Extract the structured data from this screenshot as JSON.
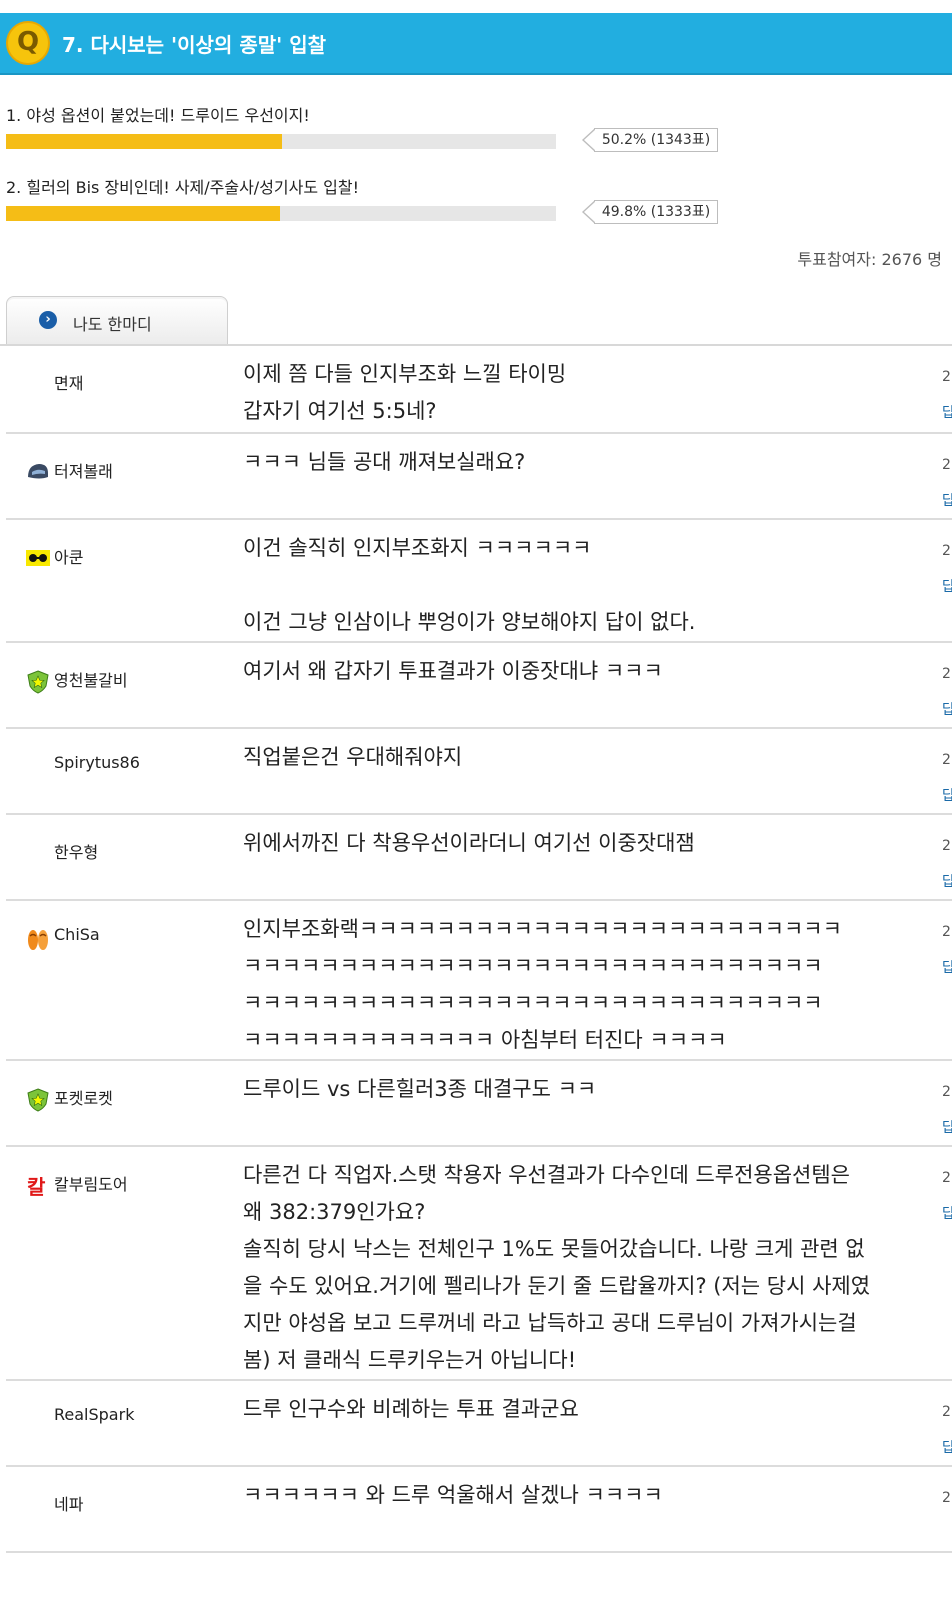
{
  "poll": {
    "badge": "Q",
    "question": "7. 다시보는 '이상의 종말' 입찰",
    "options": [
      {
        "label": "1.  야성 옵션이 붙었는데! 드루이드 우선이지!",
        "percent": 50.2,
        "result": "50.2% (1343표)"
      },
      {
        "label": "2.  힐러의 Bis 장비인데! 사제/주술사/성기사도 입찰!",
        "percent": 49.8,
        "result": "49.8% (1333표)"
      }
    ],
    "total": "투표참여자: 2676 명",
    "bar_color": "#f5bd16",
    "header_color": "#22aee0"
  },
  "tab": {
    "label": "나도 한마디",
    "icon": "chevron-right-circle-icon"
  },
  "comments": [
    {
      "user": "면재",
      "icon": "none",
      "lines": [
        "이제 쯤 다들 인지부조화 느낄 타이밍",
        "갑자기 여기선 5:5네?"
      ],
      "meta": [
        "2",
        "답"
      ]
    },
    {
      "user": "터져볼래",
      "icon": "helmet-icon",
      "lines": [
        "ㅋㅋㅋ 님들 공대 깨져보실래요?"
      ],
      "meta": [
        "2",
        "답"
      ]
    },
    {
      "user": "아쿤",
      "icon": "goggles-icon",
      "lines": [
        "이건 솔직히 인지부조화지 ㅋㅋㅋㅋㅋㅋ",
        "",
        "이건 그냥 인삼이나 뿌엉이가 양보해야지 답이 없다."
      ],
      "meta": [
        "2",
        "답"
      ]
    },
    {
      "user": "영천불갈비",
      "icon": "star-shield-icon",
      "lines": [
        "여기서 왜 갑자기 투표결과가 이중잣대냐 ㅋㅋㅋ"
      ],
      "meta": [
        "2",
        "답"
      ]
    },
    {
      "user": "Spirytus86",
      "icon": "none",
      "lines": [
        "직업붙은건 우대해줘야지"
      ],
      "meta": [
        "2",
        "답"
      ]
    },
    {
      "user": "한우형",
      "icon": "none",
      "lines": [
        "위에서까진 다 착용우선이라더니 여기선 이중잣대잼"
      ],
      "meta": [
        "2",
        "답"
      ]
    },
    {
      "user": "ChiSa",
      "icon": "sandals-icon",
      "lines": [
        "인지부조화랙ㅋㅋㅋㅋㅋㅋㅋㅋㅋㅋㅋㅋㅋㅋㅋㅋㅋㅋㅋㅋㅋㅋㅋㅋㅋ",
        "ㅋㅋㅋㅋㅋㅋㅋㅋㅋㅋㅋㅋㅋㅋㅋㅋㅋㅋㅋㅋㅋㅋㅋㅋㅋㅋㅋㅋㅋㅋ",
        "ㅋㅋㅋㅋㅋㅋㅋㅋㅋㅋㅋㅋㅋㅋㅋㅋㅋㅋㅋㅋㅋㅋㅋㅋㅋㅋㅋㅋㅋㅋ",
        "ㅋㅋㅋㅋㅋㅋㅋㅋㅋㅋㅋㅋㅋ 아침부터 터진다 ㅋㅋㅋㅋ"
      ],
      "meta": [
        "2",
        "답"
      ]
    },
    {
      "user": "포켓로켓",
      "icon": "star-shield-icon",
      "lines": [
        "드루이드 vs 다른힐러3종 대결구도 ㅋㅋ"
      ],
      "meta": [
        "2",
        "답"
      ]
    },
    {
      "user": "칼부림도어",
      "icon": "kal-icon",
      "lines": [
        "다른건 다 직업자.스탯 착용자 우선결과가 다수인데 드루전용옵션템은",
        "왜 382:379인가요?",
        "솔직히 당시 낙스는 전체인구 1%도 못들어갔습니다. 나랑 크게 관련 없",
        "을 수도 있어요.거기에 펠리나가 둔기 줄 드랍율까지? (저는 당시 사제였",
        "지만 야성옵 보고 드루꺼네 라고 납득하고 공대 드루님이 가져가시는걸",
        "봄) 저 클래식 드루키우는거 아닙니다!"
      ],
      "meta": [
        "2",
        "답"
      ]
    },
    {
      "user": "RealSpark",
      "icon": "none",
      "lines": [
        "드루 인구수와 비례하는 투표 결과군요"
      ],
      "meta": [
        "2",
        "답"
      ]
    },
    {
      "user": "네파",
      "icon": "none",
      "lines": [
        "ㅋㅋㅋㅋㅋㅋ 와 드루 억울해서 살겠나 ㅋㅋㅋㅋ"
      ],
      "meta": [
        "2"
      ]
    }
  ]
}
